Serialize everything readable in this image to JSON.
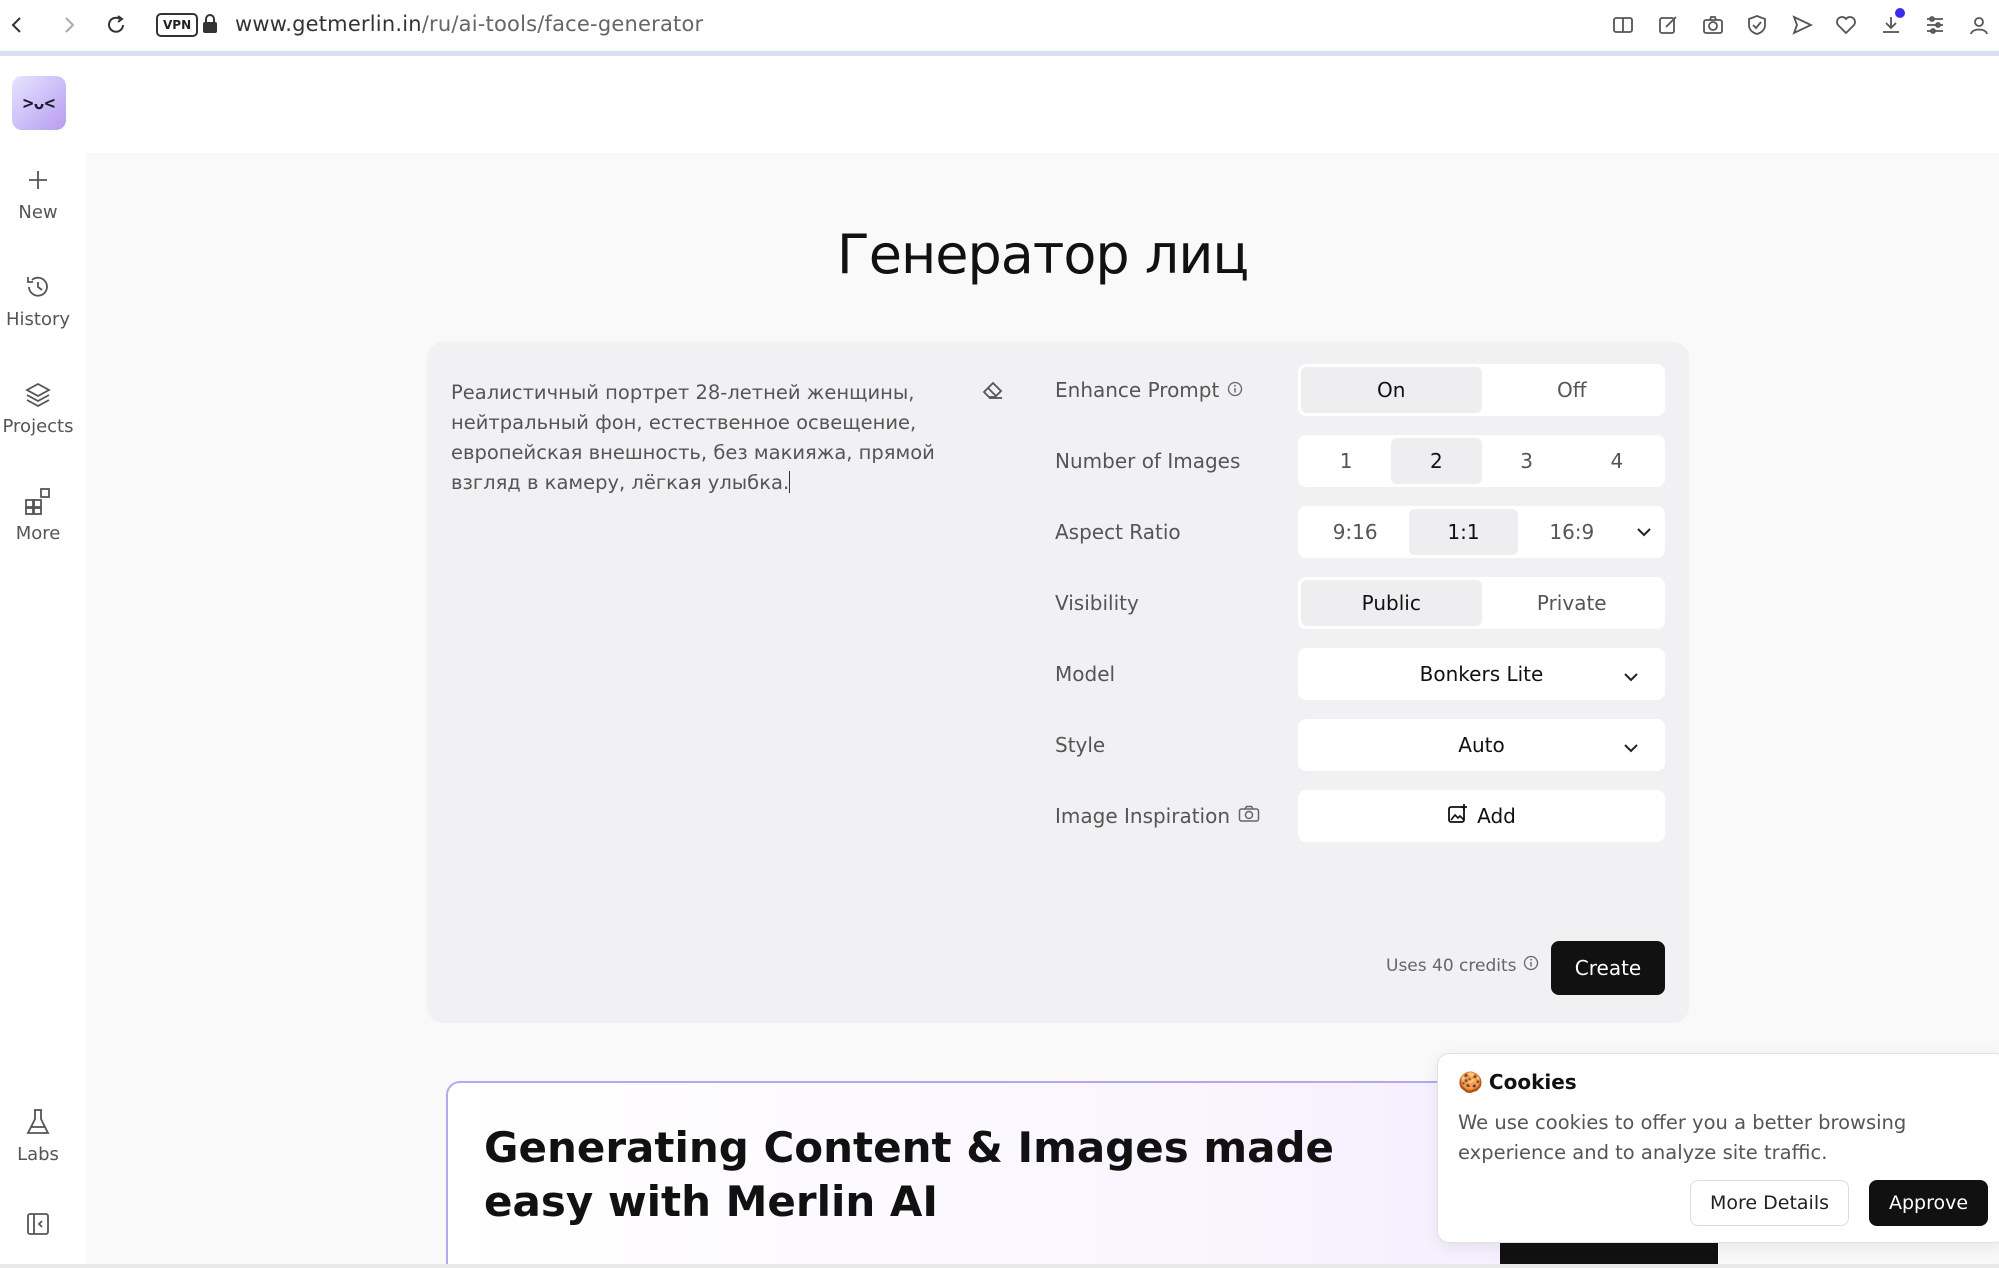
{
  "browser": {
    "url_host": "www.getmerlin.in",
    "url_path": "/ru/ai-tools/face-generator",
    "vpn_label": "VPN"
  },
  "sidebar": {
    "logo_text": ">ᴗ<",
    "items": [
      {
        "label": "New",
        "icon": "plus-icon"
      },
      {
        "label": "History",
        "icon": "history-icon"
      },
      {
        "label": "Projects",
        "icon": "layers-icon"
      },
      {
        "label": "More",
        "icon": "grid-icon"
      }
    ],
    "labs_label": "Labs"
  },
  "main": {
    "title": "Генератор лиц",
    "prompt_text": "Реалистичный портрет 28-летней женщины, нейтральный фон, естественное освещение, европейская внешность, без макияжа, прямой взгляд в камеру, лёгкая улыбка.",
    "settings": {
      "enhance_prompt": {
        "label": "Enhance Prompt",
        "options": [
          "On",
          "Off"
        ],
        "selected": "On"
      },
      "number_of_images": {
        "label": "Number of Images",
        "options": [
          "1",
          "2",
          "3",
          "4"
        ],
        "selected": "2"
      },
      "aspect_ratio": {
        "label": "Aspect Ratio",
        "options": [
          "9:16",
          "1:1",
          "16:9"
        ],
        "selected": "1:1"
      },
      "visibility": {
        "label": "Visibility",
        "options": [
          "Public",
          "Private"
        ],
        "selected": "Public"
      },
      "model": {
        "label": "Model",
        "value": "Bonkers Lite"
      },
      "style": {
        "label": "Style",
        "value": "Auto"
      },
      "image_inspiration": {
        "label": "Image Inspiration",
        "button": "Add"
      }
    },
    "credits_text": "Uses 40 credits",
    "create_label": "Create"
  },
  "promo": {
    "title": "Generating Content & Images made easy with Merlin AI"
  },
  "cookies": {
    "title": "Cookies",
    "emoji": "🍪",
    "text": "We use cookies to offer you a better browsing experience and to analyze site traffic.",
    "more_label": "More Details",
    "approve_label": "Approve"
  },
  "colors": {
    "accent_dark": "#111111",
    "promo_border": "#b5a6ee",
    "download_dot": "#3d2cf0"
  }
}
